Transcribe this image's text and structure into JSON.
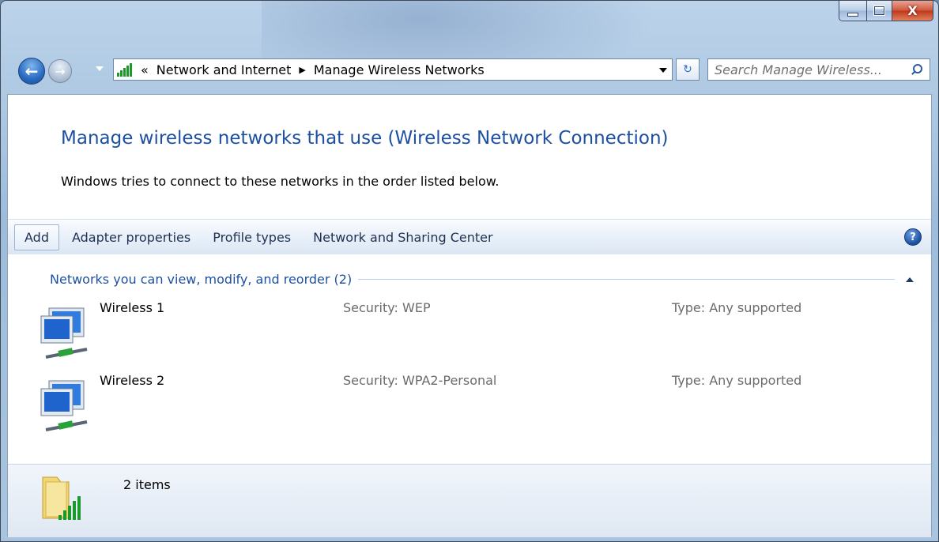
{
  "window": {
    "caption": {
      "close_glyph": "X"
    }
  },
  "nav": {
    "back_glyph": "←",
    "forward_glyph": "→",
    "breadcrumb_overflow": "«",
    "breadcrumb": [
      "Network and Internet",
      "Manage Wireless Networks"
    ],
    "breadcrumb_sep": "▶",
    "refresh_glyph": "↻",
    "search_placeholder": "Search Manage Wireless..."
  },
  "page": {
    "title": "Manage wireless networks that use (Wireless Network Connection)",
    "subtitle": "Windows tries to connect to these networks in the order listed below."
  },
  "commandbar": {
    "items": [
      "Add",
      "Adapter properties",
      "Profile types",
      "Network and Sharing Center"
    ],
    "help_glyph": "?"
  },
  "group": {
    "label": "Networks you can view, modify, and reorder (2)"
  },
  "networks": [
    {
      "name": "Wireless 1",
      "security": "Security:  WEP",
      "type": "Type:  Any supported"
    },
    {
      "name": "Wireless 2",
      "security": "Security:  WPA2-Personal",
      "type": "Type:  Any supported"
    }
  ],
  "status": {
    "count": "2 items"
  },
  "icons": {
    "back": "back-arrow-icon",
    "forward": "forward-arrow-icon",
    "network": "wireless-network-icon",
    "search": "search-icon",
    "help": "help-icon",
    "status": "folder-signal-icon"
  },
  "colors": {
    "title_blue": "#1e50a2",
    "signal_green": "#1a9a2b",
    "close_red": "#c0381a"
  }
}
